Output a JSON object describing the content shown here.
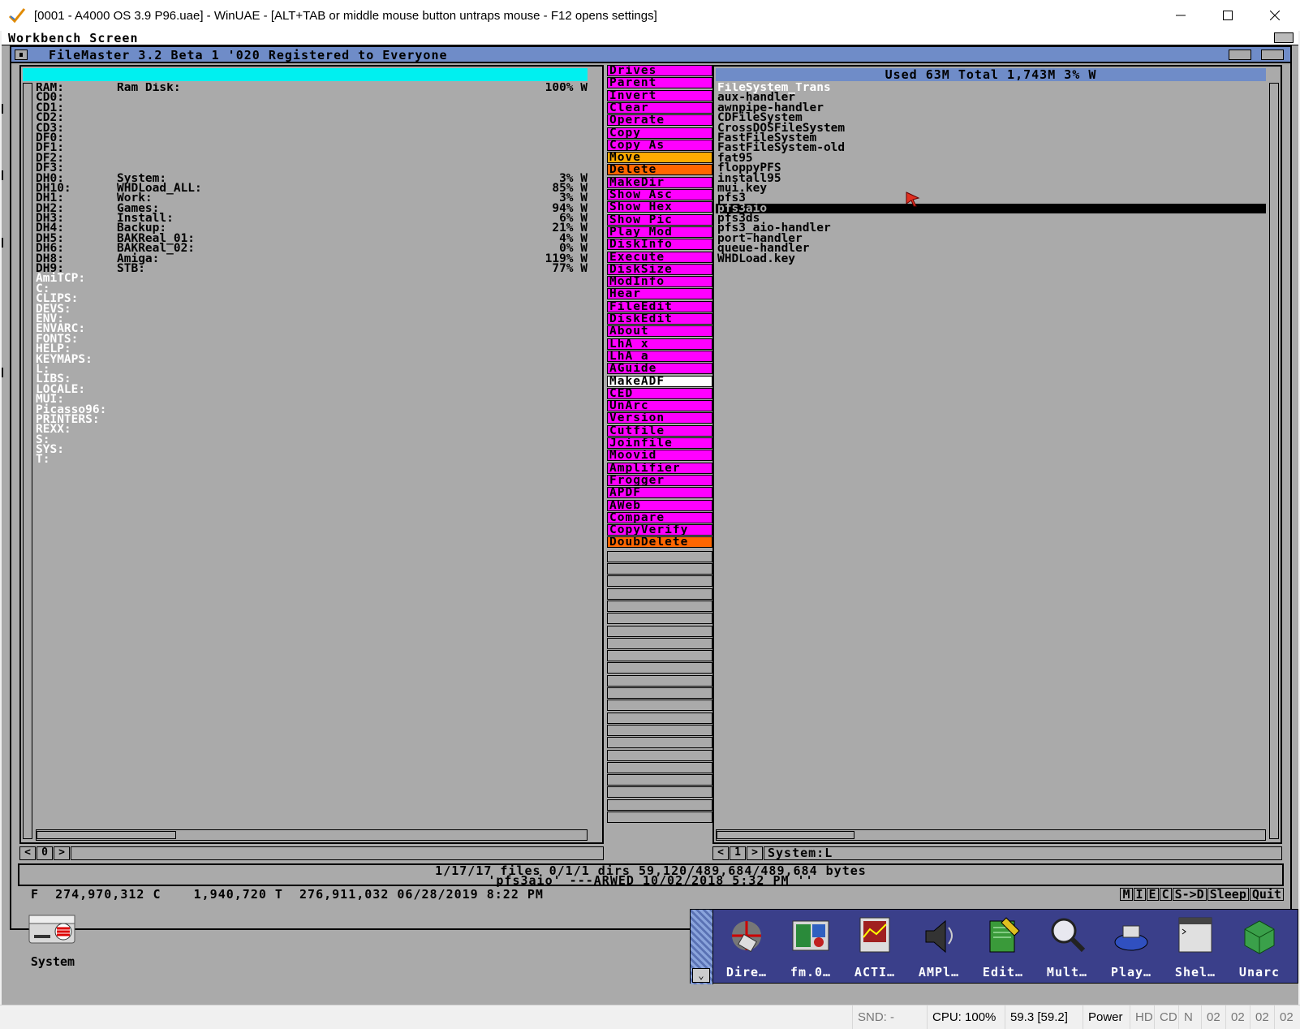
{
  "window": {
    "title": "[0001 - A4000 OS 3.9 P96.uae] - WinUAE - [ALT+TAB or middle mouse button untraps mouse - F12 opens settings]",
    "minimize_glyph": "—",
    "maximize_glyph": "☐",
    "close_glyph": "✕"
  },
  "screen": {
    "title": "Workbench Screen"
  },
  "filemaster": {
    "title": "FileMaster 3.2 Beta 1 '020 Registered to Everyone",
    "left_panel": {
      "header": "",
      "devices": [
        {
          "dev": "RAM:",
          "name": "Ram Disk:",
          "pct": "100% W"
        },
        {
          "dev": "CD0:",
          "name": "",
          "pct": ""
        },
        {
          "dev": "CD1:",
          "name": "",
          "pct": ""
        },
        {
          "dev": "CD2:",
          "name": "",
          "pct": ""
        },
        {
          "dev": "CD3:",
          "name": "",
          "pct": ""
        },
        {
          "dev": "DF0:",
          "name": "",
          "pct": ""
        },
        {
          "dev": "DF1:",
          "name": "",
          "pct": ""
        },
        {
          "dev": "DF2:",
          "name": "",
          "pct": ""
        },
        {
          "dev": "DF3:",
          "name": "",
          "pct": ""
        },
        {
          "dev": "DH0:",
          "name": "System:",
          "pct": "3% W"
        },
        {
          "dev": "DH10:",
          "name": "WHDLoad_ALL:",
          "pct": "85% W"
        },
        {
          "dev": "DH1:",
          "name": "Work:",
          "pct": "3% W"
        },
        {
          "dev": "DH2:",
          "name": "Games:",
          "pct": "94% W"
        },
        {
          "dev": "DH3:",
          "name": "Install:",
          "pct": "6% W"
        },
        {
          "dev": "DH4:",
          "name": "Backup:",
          "pct": "21% W"
        },
        {
          "dev": "DH5:",
          "name": "BAKReal_01:",
          "pct": "4% W"
        },
        {
          "dev": "DH6:",
          "name": "BAKReal_02:",
          "pct": "0% W"
        },
        {
          "dev": "DH8:",
          "name": "Amiga:",
          "pct": "119% W"
        },
        {
          "dev": "DH9:",
          "name": "STB:",
          "pct": "77% W"
        }
      ],
      "assigns": [
        "AmiTCP:",
        "C:",
        "CLIPS:",
        "DEVS:",
        "ENV:",
        "ENVARC:",
        "FONTS:",
        "HELP:",
        "KEYMAPS:",
        "L:",
        "LIBS:",
        "LOCALE:",
        "MUI:",
        "Picasso96:",
        "PRINTERS:",
        "REXX:",
        "S:",
        "SYS:",
        "T:"
      ],
      "footer": {
        "prev": "<",
        "num": "0",
        "next": ">",
        "path": ""
      }
    },
    "right_panel": {
      "header": "Used 63M Total 1,743M 3% W",
      "files": [
        "FileSystem_Trans",
        "aux-handler",
        "awnpipe-handler",
        "CDFileSystem",
        "CrossDOSFileSystem",
        "FastFileSystem",
        "FastFileSystem-old",
        "fat95",
        "floppyPFS",
        "install95",
        "mui.key",
        "pfs3",
        "pfs3aio",
        "pfs3ds",
        "pfs3_aio-handler",
        "port-handler",
        "queue-handler",
        "WHDLoad.key"
      ],
      "selected_index": 12,
      "footer": {
        "prev": "<",
        "num": "1",
        "next": ">",
        "path": "System:L"
      }
    },
    "buttons": [
      {
        "label": "Drives",
        "color": "#ff00ff"
      },
      {
        "label": "Parent",
        "color": "#ff00ff"
      },
      {
        "label": "Invert",
        "color": "#ff00ff"
      },
      {
        "label": "Clear",
        "color": "#ff00ff"
      },
      {
        "label": "Operate",
        "color": "#ff00ff"
      },
      {
        "label": "Copy",
        "color": "#ff00ff"
      },
      {
        "label": "Copy As",
        "color": "#ff00ff"
      },
      {
        "label": "Move",
        "color": "#ffaa00"
      },
      {
        "label": "Delete",
        "color": "#ff6600"
      },
      {
        "label": "MakeDir",
        "color": "#ff00ff"
      },
      {
        "label": "Show Asc",
        "color": "#ff00ff"
      },
      {
        "label": "Show Hex",
        "color": "#ff00ff"
      },
      {
        "label": "Show Pic",
        "color": "#ff00ff"
      },
      {
        "label": "Play Mod",
        "color": "#ff00ff"
      },
      {
        "label": "DiskInfo",
        "color": "#ff00ff"
      },
      {
        "label": "Execute",
        "color": "#ff00ff"
      },
      {
        "label": "DiskSize",
        "color": "#ff00ff"
      },
      {
        "label": "ModInfo",
        "color": "#ff00ff"
      },
      {
        "label": "Hear",
        "color": "#ff00ff"
      },
      {
        "label": "FileEdit",
        "color": "#ff00ff"
      },
      {
        "label": "DiskEdit",
        "color": "#ff00ff"
      },
      {
        "label": "About",
        "color": "#ff00ff"
      },
      {
        "label": "LhA x",
        "color": "#ff00ff"
      },
      {
        "label": "LhA a",
        "color": "#ff00ff"
      },
      {
        "label": "AGuide",
        "color": "#ff00ff"
      },
      {
        "label": "MakeADF",
        "color": "#ffffff"
      },
      {
        "label": "CED",
        "color": "#ff00ff"
      },
      {
        "label": "UnArc",
        "color": "#ff00ff"
      },
      {
        "label": "Version",
        "color": "#ff00ff"
      },
      {
        "label": "Cutfile",
        "color": "#ff00ff"
      },
      {
        "label": "Joinfile",
        "color": "#ff00ff"
      },
      {
        "label": "Moovid",
        "color": "#ff00ff"
      },
      {
        "label": "Amplifier",
        "color": "#ff00ff"
      },
      {
        "label": "Frogger",
        "color": "#ff00ff"
      },
      {
        "label": "APDF",
        "color": "#ff00ff"
      },
      {
        "label": "AWeb",
        "color": "#ff00ff"
      },
      {
        "label": "Compare",
        "color": "#ff00ff"
      },
      {
        "label": "CopyVerify",
        "color": "#ff00ff"
      },
      {
        "label": "DoubDelete",
        "color": "#ff6600"
      }
    ],
    "empty_button_count": 22,
    "status_line1": "1/17/17 files 0/1/1 dirs 59,120/489,684/489,684 bytes",
    "status_line2": "'pfs3aio' ---ARWED 10/02/2018 5:32 PM ''",
    "memory_line": "F  274,970,312 C    1,940,720 T  276,911,032 06/28/2019 8:22 PM",
    "bottom_buttons": [
      "M",
      "I",
      "E",
      "C",
      "S->D",
      "Sleep",
      "Quit"
    ]
  },
  "desktop": {
    "icon_label": "System"
  },
  "dock": {
    "scroll_glyph": "⌄",
    "items": [
      {
        "label": "Dire…",
        "icon": "directory-opus-icon"
      },
      {
        "label": "fm.0…",
        "icon": "filemaster-icon"
      },
      {
        "label": "ACTI…",
        "icon": "activity-monitor-icon"
      },
      {
        "label": "AMPl…",
        "icon": "amplifier-speaker-icon"
      },
      {
        "label": "Edit…",
        "icon": "editor-notepad-icon"
      },
      {
        "label": "Mult…",
        "icon": "multiview-magnifier-icon"
      },
      {
        "label": "Play…",
        "icon": "player-icon"
      },
      {
        "label": "Shel…",
        "icon": "shell-terminal-icon"
      },
      {
        "label": "Unarc",
        "icon": "unarc-box-icon"
      }
    ]
  },
  "statusbar": {
    "snd": "SND: -",
    "cpu": "CPU: 100%",
    "fps": "59.3 [59.2]",
    "power": "Power",
    "hd": "HD",
    "cd": "CD",
    "n": "N",
    "drives": [
      "02",
      "02",
      "02",
      "02"
    ]
  },
  "colors": {
    "amiga_grey": "#aaaaaa",
    "title_blue": "#6f8cc8",
    "left_header_cyan": "#00f0f0",
    "selection_black": "#000000",
    "dock_bg": "#3a3f8a"
  }
}
